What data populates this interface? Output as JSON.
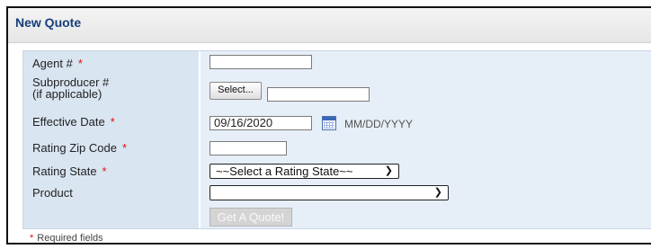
{
  "header": {
    "title": "New Quote"
  },
  "form": {
    "agent": {
      "label": "Agent #",
      "required_mark": "*",
      "value": ""
    },
    "subproducer": {
      "label_line1": "Subproducer #",
      "label_line2": "(if applicable)",
      "button_label": "Select...",
      "value": ""
    },
    "effective_date": {
      "label": "Effective Date",
      "required_mark": "*",
      "value": "09/16/2020",
      "format_hint": "MM/DD/YYYY"
    },
    "rating_zip": {
      "label": "Rating Zip Code",
      "required_mark": "*",
      "value": ""
    },
    "rating_state": {
      "label": "Rating State",
      "required_mark": "*",
      "selected": "~~Select a Rating State~~"
    },
    "product": {
      "label": "Product",
      "selected": ""
    },
    "submit": {
      "label": "Get A Quote!"
    }
  },
  "footer": {
    "required_mark": "*",
    "required_text": "Required fields"
  },
  "colors": {
    "title": "#163f7a",
    "label_bg": "#d9e5f1",
    "value_bg": "#e6eef7",
    "required": "#dd1111"
  }
}
